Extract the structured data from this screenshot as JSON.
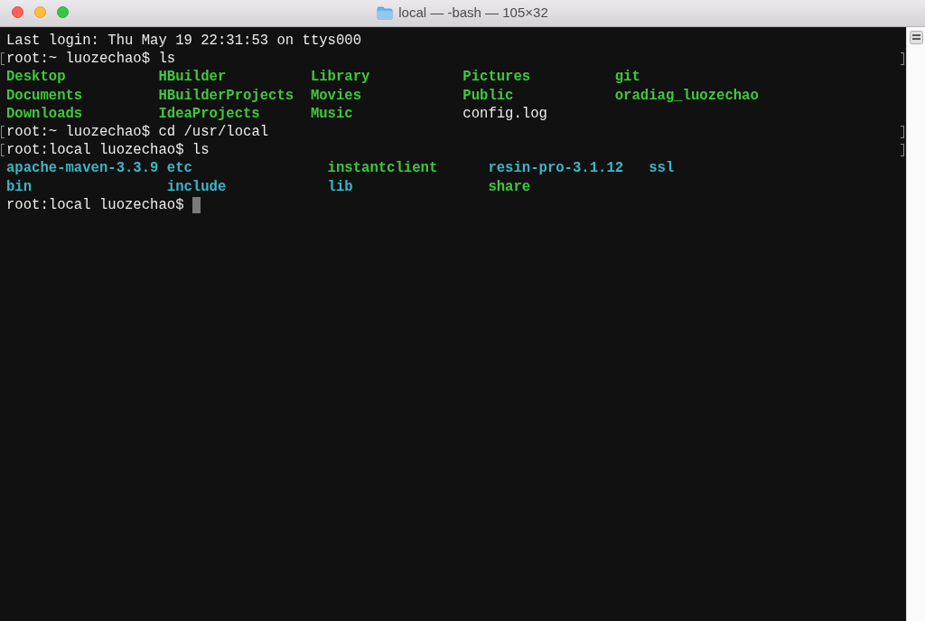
{
  "window": {
    "title": "local — -bash — 105×32"
  },
  "terminal": {
    "lines": [
      {
        "kind": "text",
        "marked": false,
        "text": "Last login: Thu May 19 22:31:53 on ttys000"
      },
      {
        "kind": "text",
        "marked": true,
        "text": "root:~ luozechao$ ls"
      },
      {
        "kind": "listing",
        "rows": [
          [
            {
              "name": "Desktop",
              "color": "#3fc93c",
              "bold": true
            },
            {
              "name": "HBuilder",
              "color": "#3fc93c",
              "bold": true
            },
            {
              "name": "Library",
              "color": "#3fc93c",
              "bold": true
            },
            {
              "name": "Pictures",
              "color": "#3fc93c",
              "bold": true
            },
            {
              "name": "git",
              "color": "#3fc93c",
              "bold": true
            }
          ],
          [
            {
              "name": "Documents",
              "color": "#3fc93c",
              "bold": true
            },
            {
              "name": "HBuilderProjects",
              "color": "#3fc93c",
              "bold": true
            },
            {
              "name": "Movies",
              "color": "#3fc93c",
              "bold": true
            },
            {
              "name": "Public",
              "color": "#3fc93c",
              "bold": true
            },
            {
              "name": "oradiag_luozechao",
              "color": "#3fc93c",
              "bold": true
            }
          ],
          [
            {
              "name": "Downloads",
              "color": "#3fc93c",
              "bold": true
            },
            {
              "name": "IdeaProjects",
              "color": "#3fc93c",
              "bold": true
            },
            {
              "name": "Music",
              "color": "#3fc93c",
              "bold": true
            },
            {
              "name": "config.log",
              "color": "#ececec",
              "bold": false
            }
          ]
        ]
      },
      {
        "kind": "text",
        "marked": true,
        "text": "root:~ luozechao$ cd /usr/local"
      },
      {
        "kind": "text",
        "marked": true,
        "text": "root:local luozechao$ ls"
      },
      {
        "kind": "listing",
        "rows": [
          [
            {
              "name": "apache-maven-3.3.9",
              "color": "#3ab7c9",
              "bold": true
            },
            {
              "name": "etc",
              "color": "#3ab7c9",
              "bold": true
            },
            {
              "name": "instantclient",
              "color": "#3fc93c",
              "bold": true
            },
            {
              "name": "resin-pro-3.1.12",
              "color": "#3ab7c9",
              "bold": true
            },
            {
              "name": "ssl",
              "color": "#3ab7c9",
              "bold": true
            }
          ],
          [
            {
              "name": "bin",
              "color": "#3ab7c9",
              "bold": true
            },
            {
              "name": "include",
              "color": "#3ab7c9",
              "bold": true
            },
            {
              "name": "lib",
              "color": "#3ab7c9",
              "bold": true
            },
            {
              "name": "share",
              "color": "#3fc93c",
              "bold": true
            }
          ]
        ]
      },
      {
        "kind": "prompt",
        "marked": false,
        "text": "root:local luozechao$",
        "cursor": true
      }
    ]
  }
}
